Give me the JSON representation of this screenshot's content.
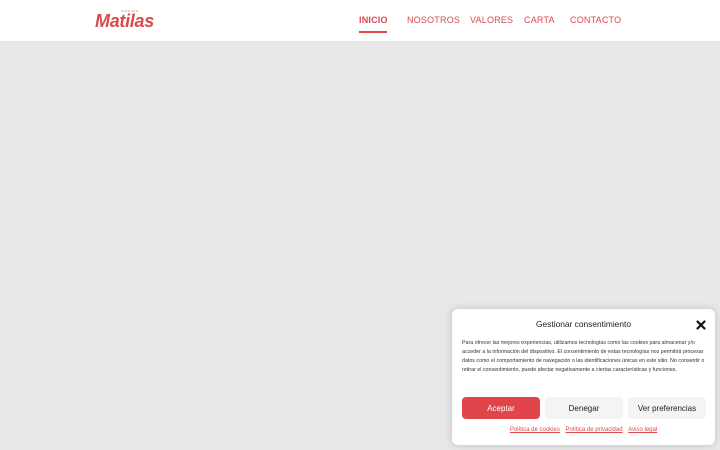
{
  "brand": {
    "small_text": "COCINA",
    "name": "Matilas",
    "color": "#d94a4f"
  },
  "nav": {
    "items": [
      {
        "label": "INICIO",
        "active": true
      },
      {
        "label": "NOSOTROS",
        "active": false
      },
      {
        "label": "VALORES",
        "active": false
      },
      {
        "label": "CARTA",
        "active": false
      },
      {
        "label": "CONTACTO",
        "active": false
      }
    ]
  },
  "cookie_banner": {
    "title": "Gestionar consentimiento",
    "close_icon": "close-icon",
    "text": "Para ofrecer las mejores experiencias, utilizamos tecnologías como las cookies para almacenar y/o acceder a la información del dispositivo. El consentimiento de estas tecnologías nos permitirá procesar datos como el comportamiento de navegación o las identificaciones únicas en este sitio. No consentir o retirar el consentimiento, puede afectar negativamente a ciertas características y funciones.",
    "accept_label": "Aceptar",
    "deny_label": "Denegar",
    "preferences_label": "Ver preferencias",
    "links": [
      "Política de cookies",
      "Política de privacidad",
      "Aviso legal"
    ],
    "accent_color": "#e0454c"
  }
}
